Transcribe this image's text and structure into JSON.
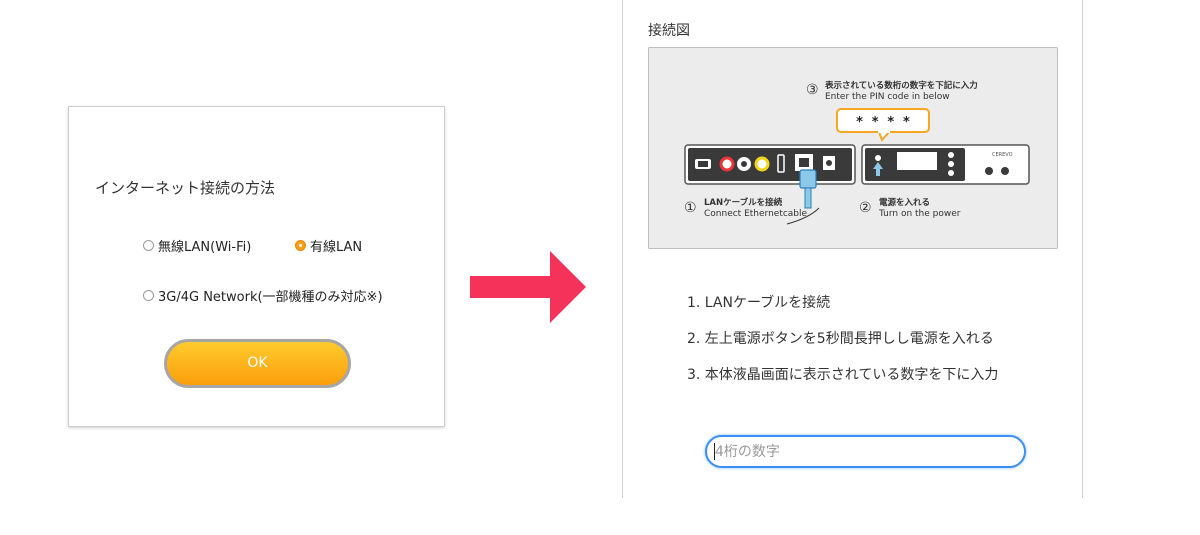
{
  "dialog": {
    "title": "インターネット接続の方法",
    "options": {
      "wifi": "無線LAN(Wi-Fi)",
      "wired": "有線LAN",
      "mobile": "3G/4G Network(一部機種のみ対応※)"
    },
    "selected": "wired",
    "ok_label": "OK"
  },
  "panel": {
    "heading": "接続図",
    "diagram": {
      "step3_title": "表示されている数桁の数字を下記に入力",
      "step3_subtitle": "Enter the PIN code in below",
      "pin_mask": "* * * *",
      "step1_title": "LANケーブルを接続",
      "step1_subtitle": "Connect Ethernetcable",
      "step2_title": "電源を入れる",
      "step2_subtitle": "Turn on the power",
      "num_1": "①",
      "num_2": "②",
      "num_3": "③",
      "brand": "CEREVO"
    },
    "steps": [
      "1. LANケーブルを接続",
      "2. 左上電源ボタンを5秒間長押しし電源を入れる",
      "3. 本体液晶画面に表示されている数字を下に入力"
    ],
    "pin_placeholder": "4桁の数字"
  },
  "colors": {
    "accent_orange": "#fb9e0b",
    "arrow_red": "#f5335a",
    "focus_blue": "#3d8ff2"
  }
}
